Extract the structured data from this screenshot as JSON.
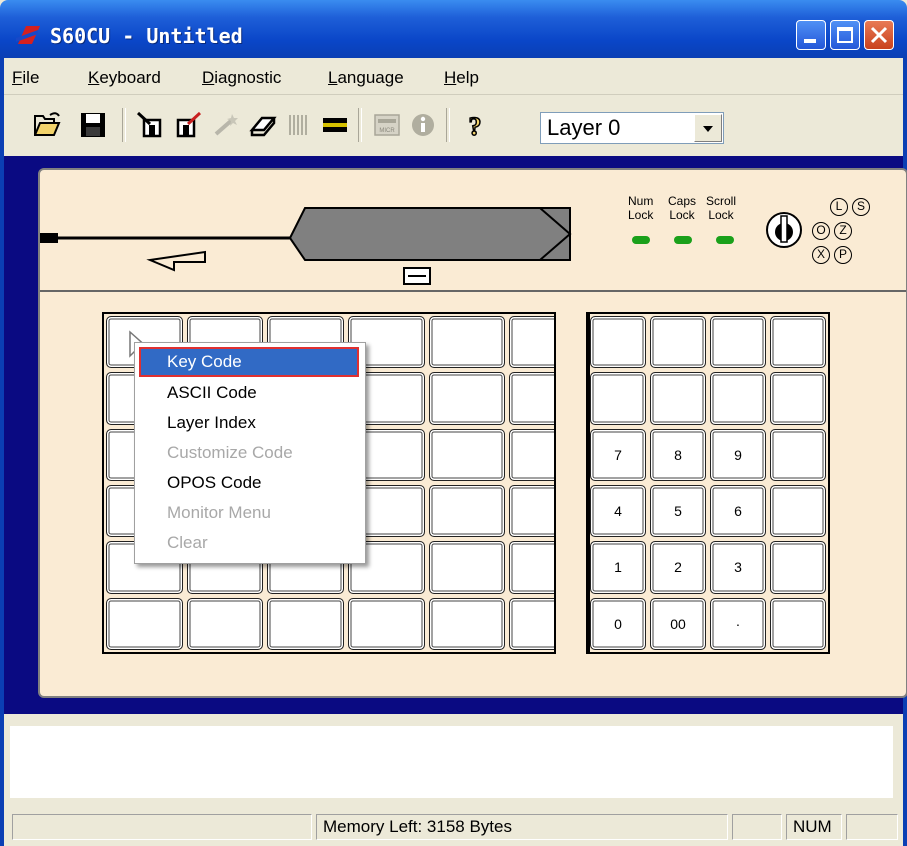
{
  "window": {
    "title": "S60CU - Untitled"
  },
  "menubar": {
    "file": {
      "mnemonic": "F",
      "rest": "ile"
    },
    "keyboard": {
      "mnemonic": "K",
      "rest": "eyboard"
    },
    "diagnostic": {
      "mnemonic": "D",
      "rest": "iagnostic"
    },
    "language": {
      "mnemonic": "L",
      "rest": "anguage"
    },
    "help": {
      "mnemonic": "H",
      "rest": "elp"
    }
  },
  "toolbar": {
    "layer_value": "Layer 0"
  },
  "indicators": {
    "num": {
      "line1": "Num",
      "line2": "Lock"
    },
    "caps": {
      "line1": "Caps",
      "line2": "Lock"
    },
    "scroll": {
      "line1": "Scroll",
      "line2": "Lock"
    },
    "led_color": "#1aa01a"
  },
  "mode_key": {
    "letters": [
      "L",
      "S",
      "O",
      "Z",
      "X",
      "P"
    ]
  },
  "numpad": {
    "row3": [
      "7",
      "8",
      "9",
      ""
    ],
    "row4": [
      "4",
      "5",
      "6",
      ""
    ],
    "row5": [
      "1",
      "2",
      "3",
      ""
    ],
    "row6": [
      "0",
      "00",
      "·",
      ""
    ]
  },
  "context_menu": {
    "items": [
      "Key Code",
      "ASCII Code",
      "Layer Index",
      "Customize Code",
      "OPOS Code",
      "Monitor Menu",
      "Clear"
    ],
    "enabled": [
      true,
      true,
      true,
      false,
      true,
      false,
      false
    ]
  },
  "statusbar": {
    "memory": "Memory Left:  3158 Bytes",
    "num": "NUM"
  },
  "colors": {
    "title_blue": "#0a46c8",
    "panel_bg": "#faebd4",
    "frame_blue": "#0a0a82",
    "highlight": "#316ac5",
    "highlight_border": "#e03030"
  }
}
